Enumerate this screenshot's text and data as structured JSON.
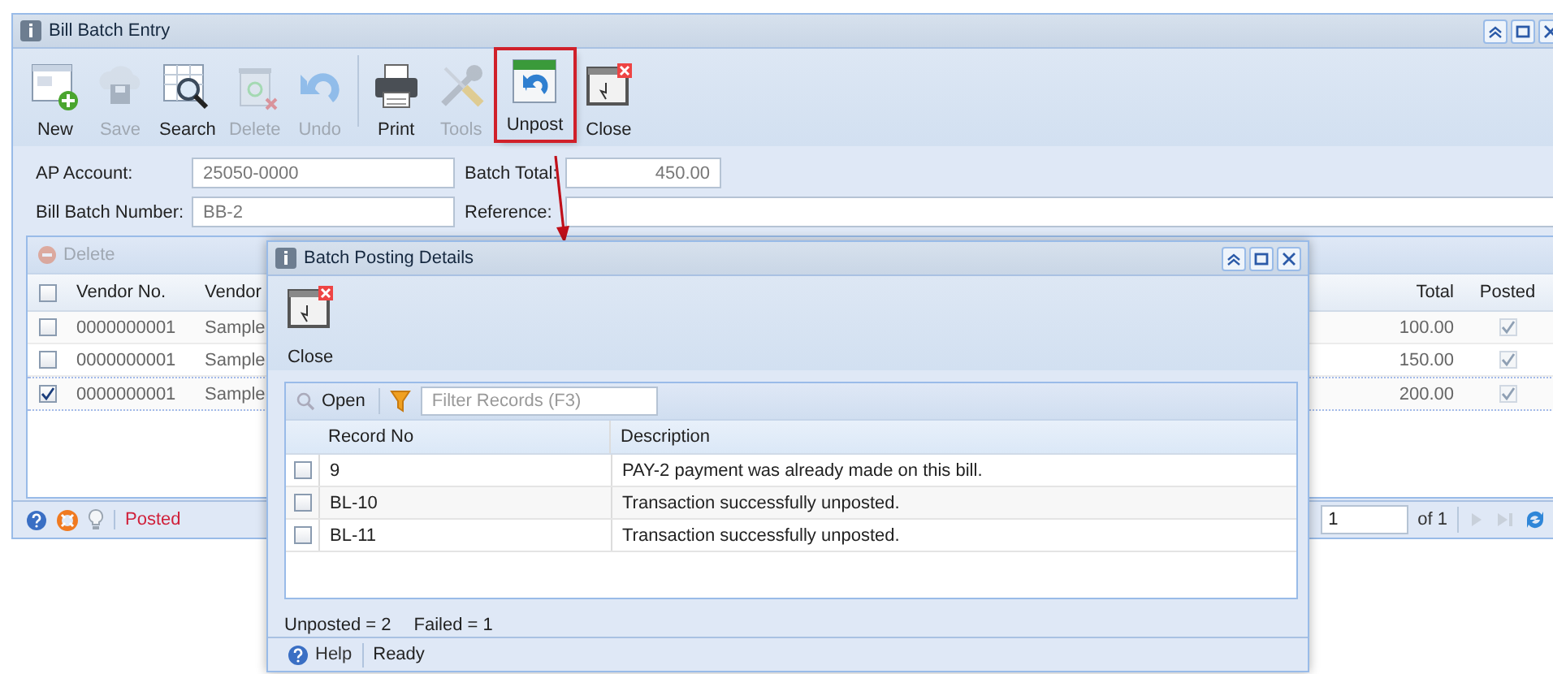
{
  "window": {
    "title": "Bill Batch Entry"
  },
  "toolbar": [
    {
      "kind": "new",
      "label": "New",
      "disabled": false,
      "highlighted": false
    },
    {
      "kind": "save",
      "label": "Save",
      "disabled": true,
      "highlighted": false
    },
    {
      "kind": "search",
      "label": "Search",
      "disabled": false,
      "highlighted": false
    },
    {
      "kind": "delete",
      "label": "Delete",
      "disabled": true,
      "highlighted": false
    },
    {
      "kind": "undo",
      "label": "Undo",
      "disabled": true,
      "highlighted": false
    },
    {
      "kind": "print",
      "label": "Print",
      "disabled": false,
      "highlighted": false
    },
    {
      "kind": "tools",
      "label": "Tools",
      "disabled": true,
      "highlighted": false
    },
    {
      "kind": "unpost",
      "label": "Unpost",
      "disabled": false,
      "highlighted": true
    },
    {
      "kind": "close",
      "label": "Close",
      "disabled": false,
      "highlighted": false
    }
  ],
  "form": {
    "ap_account": {
      "label": "AP Account:",
      "value": "25050-0000"
    },
    "batch_total": {
      "label": "Batch Total:",
      "value": "450.00"
    },
    "bill_batch_number": {
      "label": "Bill Batch Number:",
      "value": "BB-2"
    },
    "reference": {
      "label": "Reference:"
    }
  },
  "grid": {
    "delete": {
      "label": "Delete",
      "disabled": true
    },
    "select_all": {
      "checked": false
    },
    "columns": [
      "Vendor No.",
      "Vendor",
      "Total",
      "Posted"
    ],
    "rows": [
      {
        "selected": false,
        "vendor_no": "0000000001",
        "vendor_name": "Sample",
        "total": "100.00",
        "posted": true
      },
      {
        "selected": false,
        "vendor_no": "0000000001",
        "vendor_name": "Sample",
        "total": "150.00",
        "posted": true
      },
      {
        "selected": true,
        "vendor_no": "0000000001",
        "vendor_name": "Sample",
        "total": "200.00",
        "posted": true
      }
    ]
  },
  "pager": {
    "page": "1",
    "of": "of 1"
  },
  "status_bar": {
    "text": "Posted"
  },
  "dialog": {
    "title": "Batch Posting Details",
    "close_label": "Close",
    "grid": {
      "open_label": "Open",
      "filter_placeholder": "Filter Records (F3)",
      "columns": [
        "Record No",
        "Description"
      ],
      "rows": [
        {
          "checked": false,
          "record_no": "9",
          "description": "PAY-2 payment was already made on this bill."
        },
        {
          "checked": false,
          "record_no": "BL-10",
          "description": "Transaction successfully unposted."
        },
        {
          "checked": false,
          "record_no": "BL-11",
          "description": "Transaction successfully unposted."
        }
      ]
    },
    "summary": [
      "Unposted = 2",
      "Failed = 1"
    ],
    "status_bar": {
      "help": "Help",
      "text": "Ready"
    }
  }
}
